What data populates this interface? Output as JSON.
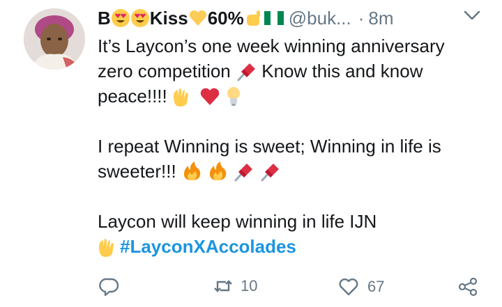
{
  "tweet": {
    "name_parts": [
      "B",
      "Kiss",
      "60%"
    ],
    "handle": "@buk...",
    "separator": "·",
    "time": "8m",
    "lines": [
      "It’s Laycon’s one week winning anniversary",
      "zero competition",
      "Know this and know",
      "peace!!!!",
      "I repeat Winning is sweet; Winning in life is",
      "sweeter!!!",
      "Laycon will keep winning in life IJN",
      "#LayconXAccolades"
    ]
  },
  "actions": {
    "retweets": "10",
    "likes": "67"
  },
  "icons": [
    "smiling-face-heart-eyes-icon",
    "yellow-heart-icon",
    "hand-icon",
    "nigeria-flag-icon",
    "pushpin-icon",
    "raised-hands-icon",
    "red-heart-icon",
    "light-bulb-icon",
    "fire-icon",
    "reply-icon",
    "retweet-icon",
    "like-icon",
    "share-icon",
    "chevron-down-icon"
  ],
  "colors": {
    "text": "#14171a",
    "muted": "#657786",
    "link": "#1b95e0"
  }
}
